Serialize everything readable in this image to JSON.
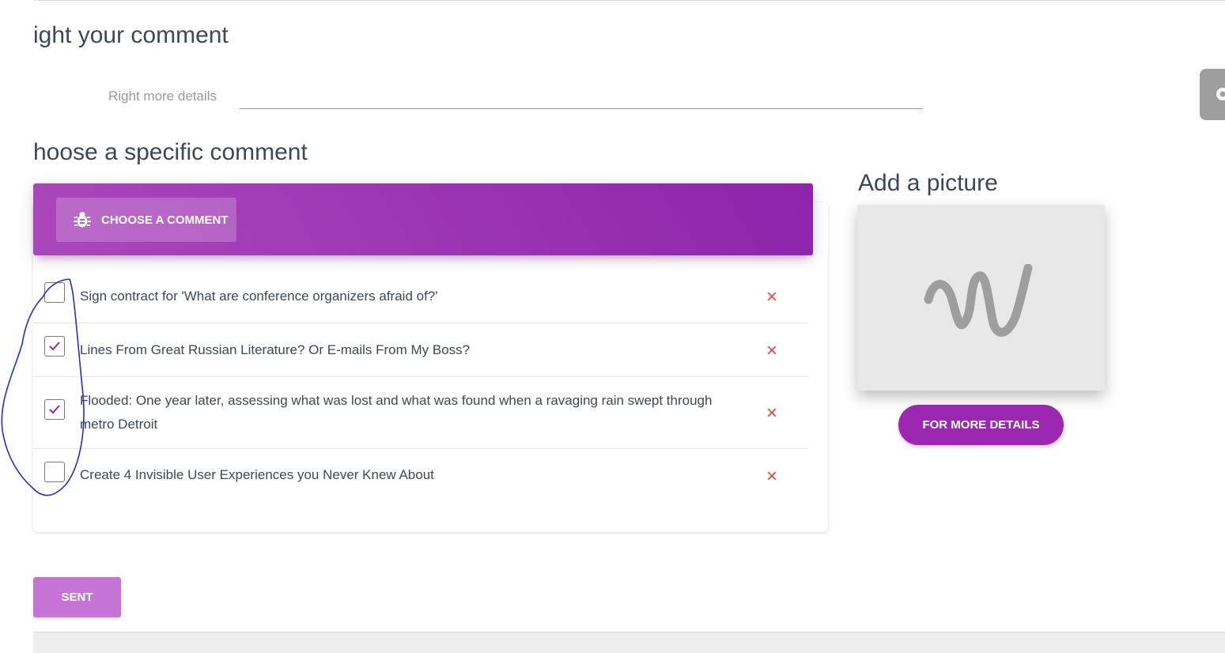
{
  "sections": {
    "comment_title": "ight your comment",
    "specific_title": "hoose a specific comment",
    "picture_title": "Add a picture"
  },
  "details": {
    "label": "Right more details",
    "value": ""
  },
  "card": {
    "tab_label": "CHOOSE A COMMENT",
    "tab_icon": "bug-icon",
    "accent": "#9c27b0"
  },
  "comments": [
    {
      "text": "Sign contract for 'What are conference organizers afraid of?'",
      "checked": false
    },
    {
      "text": "Lines From Great Russian Literature? Or E-mails From My Boss?",
      "checked": true
    },
    {
      "text": "Flooded: One year later, assessing what was lost and what was found when a ravaging rain swept through metro Detroit",
      "checked": true
    },
    {
      "text": "Create 4 Invisible User Experiences you Never Knew About",
      "checked": false
    }
  ],
  "picture": {
    "icon": "image-placeholder-icon",
    "button_label": "FOR MORE DETAILS"
  },
  "footer": {
    "sent_label": "SENT"
  }
}
